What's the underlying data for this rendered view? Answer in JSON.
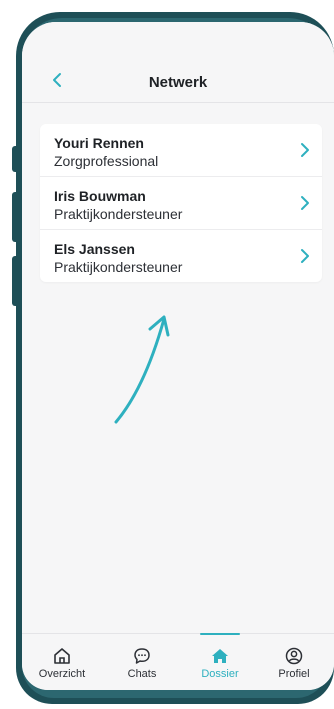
{
  "header": {
    "title": "Netwerk",
    "back_icon": "chevron-left-icon"
  },
  "contacts": [
    {
      "name": "Youri Rennen",
      "role": "Zorgprofessional"
    },
    {
      "name": "Iris Bouwman",
      "role": "Praktijkondersteuner"
    },
    {
      "name": "Els Janssen",
      "role": "Praktijkondersteuner"
    }
  ],
  "tabs": [
    {
      "label": "Overzicht",
      "icon": "home-outline-icon",
      "active": false
    },
    {
      "label": "Chats",
      "icon": "chat-bubble-icon",
      "active": false
    },
    {
      "label": "Dossier",
      "icon": "home-filled-icon",
      "active": true
    },
    {
      "label": "Profiel",
      "icon": "profile-icon",
      "active": false
    }
  ],
  "colors": {
    "accent": "#2eb0bf",
    "frame": "#2c6770",
    "background": "#f6f6f7",
    "text": "#1f2226"
  }
}
